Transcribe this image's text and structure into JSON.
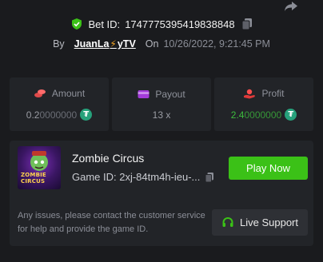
{
  "header": {
    "bet_label": "Bet ID:",
    "bet_id": "1747775395419838848",
    "by_label": "By",
    "username": "JuanLa",
    "username_suffix": "yTV",
    "on_label": "On",
    "date": "10/26/2022, 9:21:45 PM"
  },
  "stats": [
    {
      "label": "Amount",
      "value_main": "0.2",
      "value_dim": "0000000",
      "icon": "coins-icon"
    },
    {
      "label": "Payout",
      "value_main": "13 x",
      "value_dim": "",
      "icon": "wallet-icon"
    },
    {
      "label": "Profit",
      "value_main": "2.4",
      "value_dim": "0000000",
      "icon": "hand-coin-icon"
    }
  ],
  "game": {
    "name": "Zombie Circus",
    "id": "Game ID: 2xj-84tm4h-ieu-...",
    "thumb_text_1": "ZOMBIE",
    "thumb_text_2": "CIRCUS",
    "play_label": "Play Now"
  },
  "support": {
    "text": "Any issues, please contact the customer service for help and provide the game ID.",
    "button_label": "Live Support"
  },
  "colors": {
    "accent_green": "#3bc117",
    "profit_green": "#3dbd3d",
    "tether": "#26a17b",
    "background": "#1a1b1e",
    "card": "#222428"
  }
}
